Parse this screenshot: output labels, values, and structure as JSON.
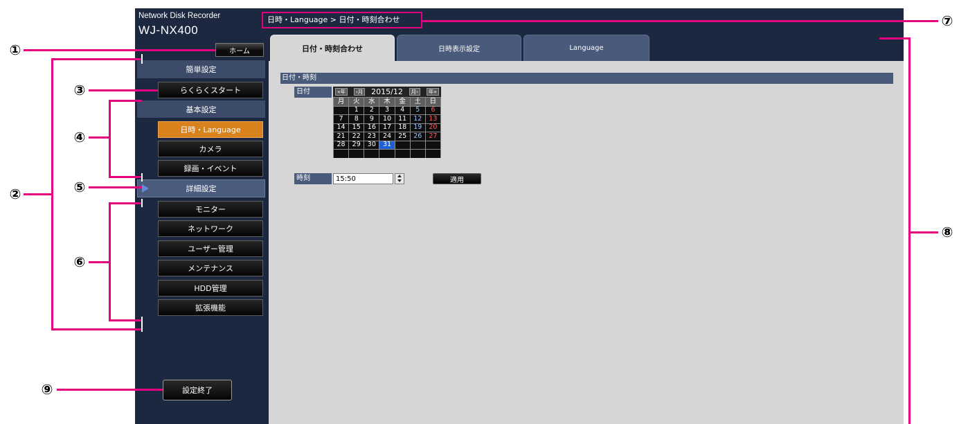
{
  "header": {
    "product_name": "Network Disk Recorder",
    "model": "WJ-NX400",
    "breadcrumb": "日時・Language > 日付・時刻合わせ"
  },
  "sidebar": {
    "home": "ホーム",
    "easy_setup": {
      "title": "簡単設定",
      "items": [
        "らくらくスタート"
      ]
    },
    "basic_setup": {
      "title": "基本設定",
      "items": [
        "日時・Language",
        "カメラ",
        "録画・イベント"
      ],
      "active_index": 0
    },
    "advanced_setup": {
      "title": "詳細設定",
      "expand_icon": "triangle-right-icon",
      "items": [
        "モニター",
        "ネットワーク",
        "ユーザー管理",
        "メンテナンス",
        "HDD管理",
        "拡張機能"
      ]
    },
    "exit": "設定終了"
  },
  "tabs": [
    {
      "label": "日付・時刻合わせ",
      "active": true
    },
    {
      "label": "日時表示設定",
      "active": false
    },
    {
      "label": "Language",
      "active": false
    }
  ],
  "main": {
    "section_title": "日付・時刻",
    "date": {
      "label": "日付",
      "calendar": {
        "prev_year": "«年",
        "prev_month": "‹月",
        "current_month": "2015/12",
        "next_month": "月›",
        "next_year": "年»",
        "weekdays": [
          "月",
          "火",
          "水",
          "木",
          "金",
          "土",
          "日"
        ],
        "weeks": [
          [
            "",
            "1",
            "2",
            "3",
            "4",
            "5",
            "6"
          ],
          [
            "7",
            "8",
            "9",
            "10",
            "11",
            "12",
            "13"
          ],
          [
            "14",
            "15",
            "16",
            "17",
            "18",
            "19",
            "20"
          ],
          [
            "21",
            "22",
            "23",
            "24",
            "25",
            "26",
            "27"
          ],
          [
            "28",
            "29",
            "30",
            "31",
            "",
            "",
            ""
          ],
          [
            "",
            "",
            "",
            "",
            "",
            "",
            ""
          ]
        ],
        "selected_day": 31
      }
    },
    "time": {
      "label": "時刻",
      "value": "15:50",
      "spinner_icons": [
        "triangle-up-icon",
        "triangle-down-icon"
      ]
    },
    "apply": "適用"
  },
  "callouts": [
    "①",
    "②",
    "③",
    "④",
    "⑤",
    "⑥",
    "⑦",
    "⑧",
    "⑨"
  ],
  "colors": {
    "panel_navy": "#1b2840",
    "menu_section": "#3c4b6a",
    "tab_inactive": "#4a5a7a",
    "active_menu_item": "#d7821c",
    "content_background": "#d6d6d6",
    "annotation": "#e4007f",
    "selected_day": "#1f5fd6",
    "sunday_text": "#ff5a5a",
    "saturday_text": "#9cc2ff"
  }
}
